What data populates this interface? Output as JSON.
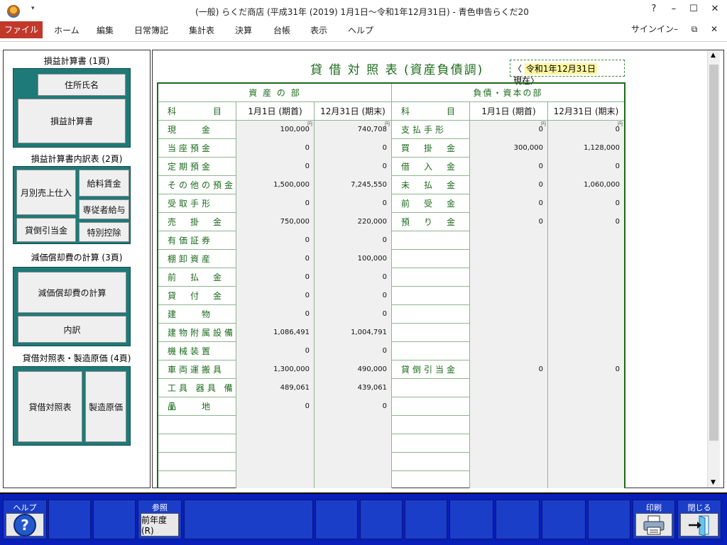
{
  "window": {
    "title": "(一般) らくだ商店 (平成31年 (2019) 1月1日～令和1年12月31日) - 青色申告らくだ20",
    "qa": "▾",
    "help": "?",
    "min": "–",
    "max": "☐",
    "close": "✕"
  },
  "menu": {
    "file": "ファイル",
    "items": [
      "ホーム",
      "編集",
      "日常簿記",
      "集計表",
      "決算",
      "台帳",
      "表示",
      "ヘルプ"
    ],
    "signin": "サインイン"
  },
  "left": {
    "sec1": "損益計算書 (1頁)",
    "address_btn": "住所氏名",
    "pl_btn": "損益計算書",
    "sec2": "損益計算書内訳表 (2頁)",
    "monthly_btn": "月別売上仕入",
    "salary_btn": "給料賃金",
    "family_btn": "専従者給与",
    "bad_debt_btn": "貸倒引当金",
    "special_btn": "特別控除",
    "sec3": "減価償却費の計算 (3頁)",
    "dep_btn": "減価償却費の計算",
    "detail_btn": "内訳",
    "sec4": "貸借対照表・製造原価 (4頁)",
    "bs_btn": "貸借対照表",
    "mfg_btn": "製造原価"
  },
  "sheet": {
    "title": "貸 借 対 照 表 (資産負債調)",
    "date_prefix": "〈",
    "date": "令和1年12月31日",
    "date_suffix": "現在〉",
    "assets_header": "資 産 の 部",
    "liab_header": "負債・資本の部",
    "col_item": "科　　　目",
    "col_start": "1月1日 (期首)",
    "col_end": "12月31日 (期末)",
    "yen": "円",
    "rows": [
      {
        "a": "現　　金",
        "a1": "100,000",
        "a2": "740,708",
        "l": "支払手形",
        "l1": "0",
        "l2": "0"
      },
      {
        "a": "当座預金",
        "a1": "0",
        "a2": "0",
        "l": "買　掛　金",
        "l1": "300,000",
        "l2": "1,128,000"
      },
      {
        "a": "定期預金",
        "a1": "0",
        "a2": "0",
        "l": "借　入　金",
        "l1": "0",
        "l2": "0"
      },
      {
        "a": "その他の預金",
        "a1": "1,500,000",
        "a2": "7,245,550",
        "l": "未　払　金",
        "l1": "0",
        "l2": "1,060,000"
      },
      {
        "a": "受取手形",
        "a1": "0",
        "a2": "0",
        "l": "前　受　金",
        "l1": "0",
        "l2": "0"
      },
      {
        "a": "売　掛　金",
        "a1": "750,000",
        "a2": "220,000",
        "l": "預　り　金",
        "l1": "0",
        "l2": "0"
      },
      {
        "a": "有価証券",
        "a1": "0",
        "a2": "0",
        "l": "",
        "l1": "",
        "l2": ""
      },
      {
        "a": "棚卸資産",
        "a1": "0",
        "a2": "100,000",
        "l": "",
        "l1": "",
        "l2": ""
      },
      {
        "a": "前　払　金",
        "a1": "0",
        "a2": "0",
        "l": "",
        "l1": "",
        "l2": ""
      },
      {
        "a": "貸　付　金",
        "a1": "0",
        "a2": "0",
        "l": "",
        "l1": "",
        "l2": ""
      },
      {
        "a": "建　　物",
        "a1": "0",
        "a2": "0",
        "l": "",
        "l1": "",
        "l2": ""
      },
      {
        "a": "建物附属設備",
        "a1": "1,086,491",
        "a2": "1,004,791",
        "l": "",
        "l1": "",
        "l2": ""
      },
      {
        "a": "機械装置",
        "a1": "0",
        "a2": "0",
        "l": "",
        "l1": "",
        "l2": ""
      },
      {
        "a": "車両運搬具",
        "a1": "1,300,000",
        "a2": "490,000",
        "l": "貸倒引当金",
        "l1": "0",
        "l2": "0"
      },
      {
        "a": "工具 器具 備品",
        "a1": "489,061",
        "a2": "439,061",
        "l": "",
        "l1": "",
        "l2": ""
      },
      {
        "a": "土　　地",
        "a1": "0",
        "a2": "0",
        "l": "",
        "l1": "",
        "l2": ""
      },
      {
        "a": "",
        "a1": "",
        "a2": "",
        "l": "",
        "l1": "",
        "l2": ""
      },
      {
        "a": "",
        "a1": "",
        "a2": "",
        "l": "",
        "l1": "",
        "l2": ""
      },
      {
        "a": "",
        "a1": "",
        "a2": "",
        "l": "",
        "l1": "",
        "l2": ""
      },
      {
        "a": "",
        "a1": "",
        "a2": "",
        "l": "",
        "l1": "",
        "l2": ""
      }
    ]
  },
  "fkeys": {
    "help_label": "ヘルプ",
    "ref_label": "参照",
    "prev_year": "前年度(R)",
    "print_label": "印刷",
    "close_label": "閉じる"
  }
}
